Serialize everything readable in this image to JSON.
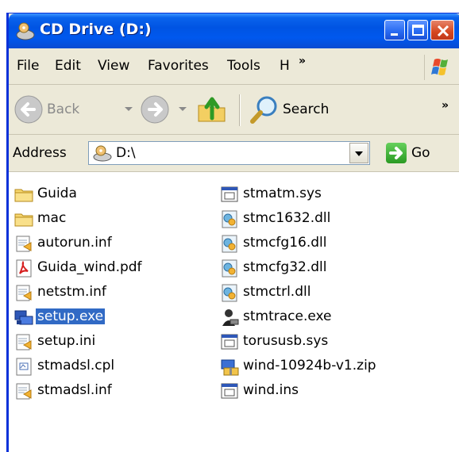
{
  "window": {
    "title": "CD Drive (D:)"
  },
  "menu": {
    "file": "File",
    "edit": "Edit",
    "view": "View",
    "favorites": "Favorites",
    "tools": "Tools",
    "help": "H",
    "overflow": "»"
  },
  "toolbar": {
    "back": "Back",
    "search": "Search",
    "overflow": "»"
  },
  "address": {
    "label": "Address",
    "value": "D:\\",
    "go": "Go"
  },
  "files": [
    {
      "name": "Guida",
      "icon": "folder-icon"
    },
    {
      "name": "mac",
      "icon": "folder-icon"
    },
    {
      "name": "autorun.inf",
      "icon": "inf-file-icon"
    },
    {
      "name": "Guida_wind.pdf",
      "icon": "pdf-file-icon"
    },
    {
      "name": "netstm.inf",
      "icon": "inf-file-icon"
    },
    {
      "name": "setup.exe",
      "icon": "setup-exe-icon",
      "selected": true
    },
    {
      "name": "setup.ini",
      "icon": "ini-file-icon"
    },
    {
      "name": "stmadsl.cpl",
      "icon": "cpl-file-icon"
    },
    {
      "name": "stmadsl.inf",
      "icon": "inf-file-icon"
    },
    {
      "name": "stmatm.sys",
      "icon": "sys-file-icon"
    },
    {
      "name": "stmc1632.dll",
      "icon": "dll-file-icon"
    },
    {
      "name": "stmcfg16.dll",
      "icon": "dll-file-icon"
    },
    {
      "name": "stmcfg32.dll",
      "icon": "dll-file-icon"
    },
    {
      "name": "stmctrl.dll",
      "icon": "dll-file-icon"
    },
    {
      "name": "stmtrace.exe",
      "icon": "trace-exe-icon"
    },
    {
      "name": "torususb.sys",
      "icon": "sys-file-icon"
    },
    {
      "name": "wind-10924b-v1.zip",
      "icon": "zip-file-icon"
    },
    {
      "name": "wind.ins",
      "icon": "ins-file-icon"
    }
  ]
}
